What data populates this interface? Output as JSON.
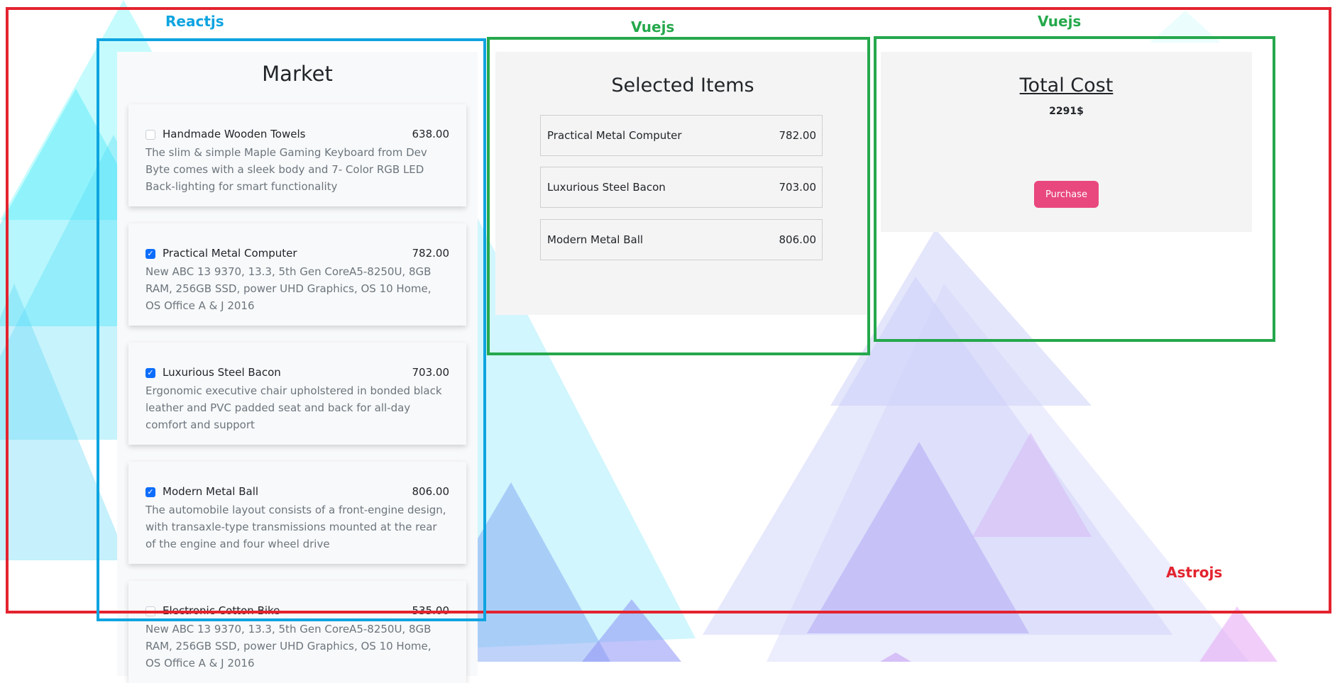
{
  "annotations": {
    "outer": {
      "label": "Astrojs",
      "color": "#e3232f"
    },
    "market": {
      "label": "Reactjs",
      "color": "#0ea4e0"
    },
    "selected": {
      "label": "Vuejs",
      "color": "#25a84c"
    },
    "total": {
      "label": "Vuejs",
      "color": "#25a84c"
    }
  },
  "market": {
    "title": "Market",
    "items": [
      {
        "name": "Handmade Wooden Towels",
        "price": "638.00",
        "checked": false,
        "description": "The slim & simple Maple Gaming Keyboard from Dev Byte comes with a sleek body and 7- Color RGB LED Back-lighting for smart functionality"
      },
      {
        "name": "Practical Metal Computer",
        "price": "782.00",
        "checked": true,
        "description": "New ABC 13 9370, 13.3, 5th Gen CoreA5-8250U, 8GB RAM, 256GB SSD, power UHD Graphics, OS 10 Home, OS Office A & J 2016"
      },
      {
        "name": "Luxurious Steel Bacon",
        "price": "703.00",
        "checked": true,
        "description": "Ergonomic executive chair upholstered in bonded black leather and PVC padded seat and back for all-day comfort and support"
      },
      {
        "name": "Modern Metal Ball",
        "price": "806.00",
        "checked": true,
        "description": "The automobile layout consists of a front-engine design, with transaxle-type transmissions mounted at the rear of the engine and four wheel drive"
      },
      {
        "name": "Electronic Cotton Bike",
        "price": "535.00",
        "checked": false,
        "description": "New ABC 13 9370, 13.3, 5th Gen CoreA5-8250U, 8GB RAM, 256GB SSD, power UHD Graphics, OS 10 Home, OS Office A & J 2016"
      }
    ]
  },
  "selected": {
    "title": "Selected Items",
    "items": [
      {
        "name": "Practical Metal Computer",
        "price": "782.00"
      },
      {
        "name": "Luxurious Steel Bacon",
        "price": "703.00"
      },
      {
        "name": "Modern Metal Ball",
        "price": "806.00"
      }
    ]
  },
  "total": {
    "title": "Total Cost",
    "amount": "2291$",
    "purchase_label": "Purchase"
  },
  "colors": {
    "accent_button": "#e8487d",
    "checkbox_checked": "#0d6efd"
  }
}
